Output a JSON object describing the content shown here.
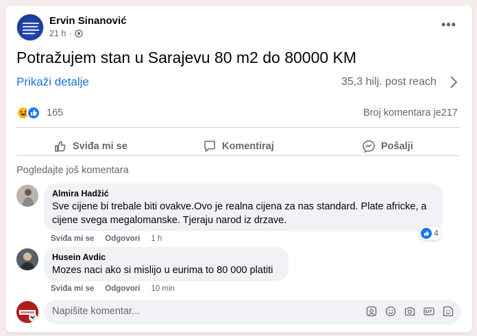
{
  "post": {
    "author": "Ervin Sinanović",
    "time": "21 h",
    "privacy_icon": "globe-icon",
    "text": "Potražujem stan u Sarajevu 80 m2 do 80000 KM",
    "details_link": "Prikaži detalje",
    "reach": "35,3 hilj. post reach",
    "reaction_count": "165",
    "comment_count": "Broj komentara je217"
  },
  "actions": {
    "like": "Sviđa mi se",
    "comment": "Komentiraj",
    "share": "Pošalji"
  },
  "comments_section": {
    "more_comments": "Pogledajte još komentara",
    "comments": [
      {
        "name": "Almira Hadžić",
        "lines": [
          "Sve cijene bi trebale biti ovakve.Ovo je realna cijena za nas standard. Plate africke, a",
          "cijene svega megalomanske. Tjeraju narod iz drzave."
        ],
        "like_label": "Sviđa mi se",
        "reply_label": "Odgovori",
        "time": "1 h",
        "reactions": "4"
      },
      {
        "name": "Husein Avdic",
        "lines": [
          "Mozes naci ako si mislijo u eurima to 80 000 platiti"
        ],
        "like_label": "Sviđa mi se",
        "reply_label": "Odgovori",
        "time": "10 min"
      }
    ]
  },
  "compose": {
    "placeholder": "Napišite komentar...",
    "icons": [
      "avatar-sticker-icon",
      "emoji-icon",
      "camera-icon",
      "gif-icon",
      "sticker-icon"
    ]
  },
  "colors": {
    "accent": "#1877f2",
    "link": "#216fdb",
    "secondary_text": "#65676b",
    "bubble": "#f0f2f5",
    "page_bg": "#f6ecec"
  }
}
